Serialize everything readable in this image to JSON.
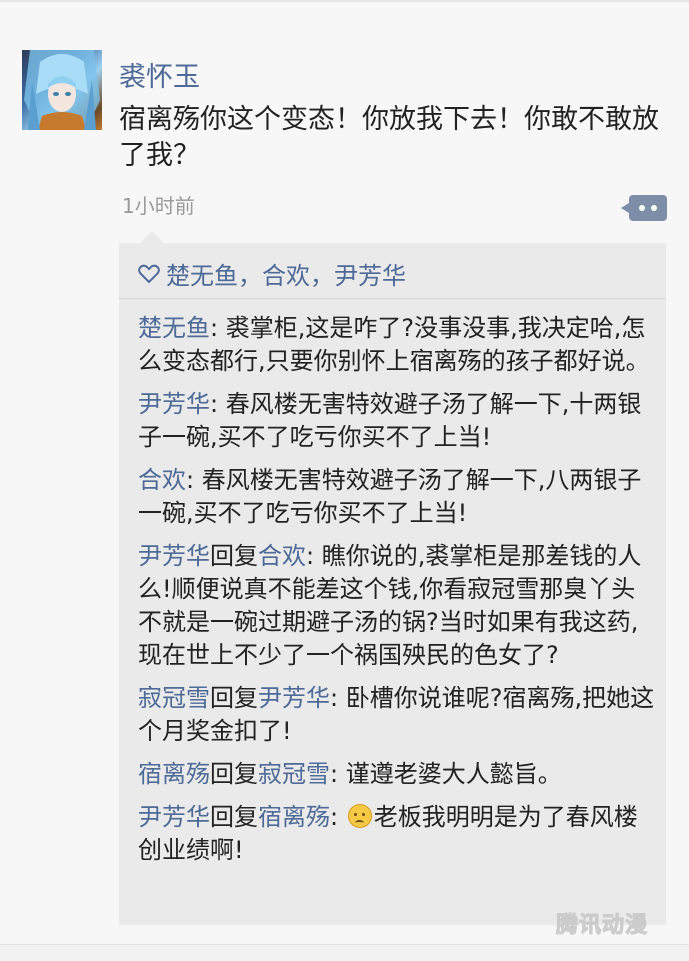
{
  "post": {
    "author": "裘怀玉",
    "text": "宿离殇你这个变态！你放我下去！你敢不敢放了我？",
    "time": "1小时前",
    "likes": "楚无鱼，合欢，尹芳华"
  },
  "comments": [
    {
      "name": "楚无鱼",
      "separator": ": ",
      "text": "裘掌柜,这是咋了?没事没事,我决定哈,怎么变态都行,只要你别怀上宿离殇的孩子都好说。"
    },
    {
      "name": "尹芳华",
      "separator": ": ",
      "text": "春风楼无害特效避子汤了解一下,十两银子一碗,买不了吃亏你买不了上当!"
    },
    {
      "name": "合欢",
      "separator": ": ",
      "text": "春风楼无害特效避子汤了解一下,八两银子一碗,买不了吃亏你买不了上当!"
    },
    {
      "name": "尹芳华",
      "reply_word": "回复",
      "reply_to": "合欢",
      "separator": ": ",
      "text": "瞧你说的,裘掌柜是那差钱的人么!顺便说真不能差这个钱,你看寂冠雪那臭丫头不就是一碗过期避子汤的锅?当时如果有我这药,现在世上不少了一个祸国殃民的色女了?"
    },
    {
      "name": "寂冠雪",
      "reply_word": "回复",
      "reply_to": "尹芳华",
      "separator": ": ",
      "text": "卧槽你说谁呢?宿离殇,把她这个月奖金扣了!"
    },
    {
      "name": "宿离殇",
      "reply_word": "回复",
      "reply_to": "寂冠雪",
      "separator": ": ",
      "text": "谨遵老婆大人懿旨。"
    },
    {
      "name": "尹芳华",
      "reply_word": "回复",
      "reply_to": "宿离殇",
      "separator": ": ",
      "emoji": "sweat-smile-icon",
      "text": "老板我明明是为了春风楼创业绩啊!"
    }
  ],
  "watermark": "腾讯动漫",
  "colors": {
    "name_link": "#4d6a98",
    "comment_bg": "#eaeaea",
    "page_bg": "#f7f7f7"
  }
}
